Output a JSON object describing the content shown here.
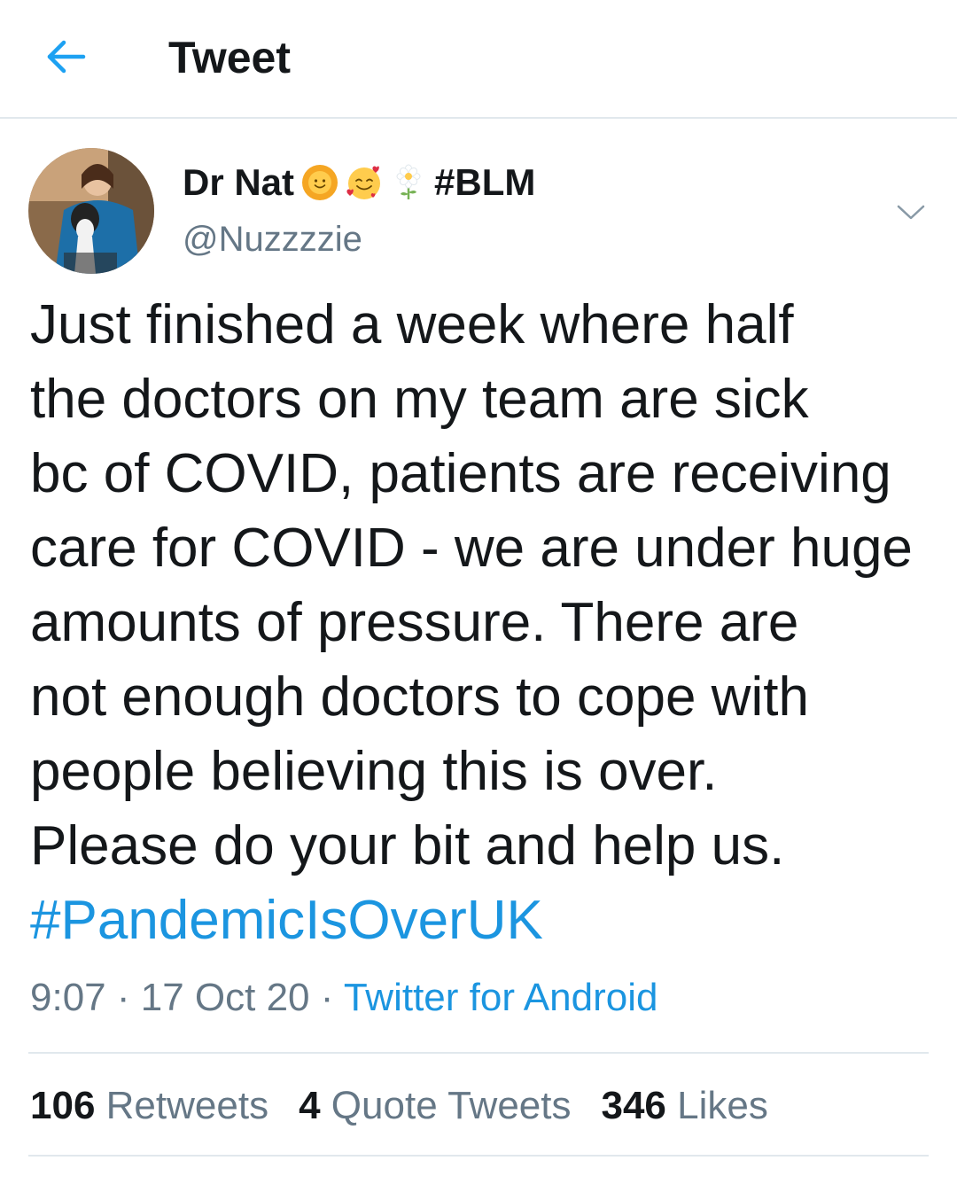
{
  "header": {
    "title": "Tweet",
    "back_icon": "arrow-left-icon",
    "accent": "#1da1f2"
  },
  "author": {
    "display_name": "Dr Nat",
    "name_emojis": [
      "sun-with-face-icon",
      "smiling-face-with-hearts-icon",
      "blossom-icon"
    ],
    "name_tag": "#BLM",
    "handle": "@Nuzzzzie"
  },
  "tweet": {
    "lines": [
      "Just finished a week where half",
      "the doctors on my team are sick",
      "bc of COVID, patients are receiving",
      "care for COVID - we are under huge",
      "amounts of pressure. There are",
      "not enough doctors to cope with",
      "people believing this is over.",
      "Please do your bit and help us."
    ],
    "hashtag": "#PandemicIsOverUK",
    "link_color": "#1b95e0"
  },
  "meta": {
    "time": "9:07",
    "separator": " · ",
    "date": "17 Oct 20",
    "source": "Twitter for Android"
  },
  "stats": {
    "retweets_count": "106",
    "retweets_label": "Retweets",
    "quotes_count": "4",
    "quotes_label": "Quote Tweets",
    "likes_count": "346",
    "likes_label": "Likes"
  }
}
